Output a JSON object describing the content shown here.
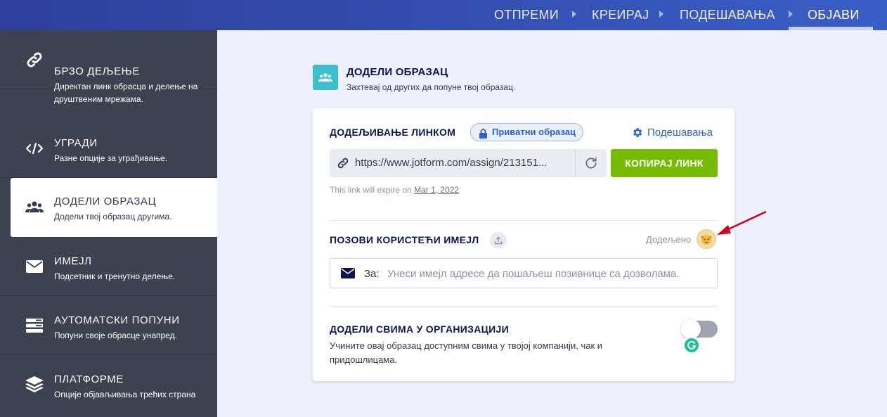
{
  "topnav": {
    "items": [
      "ОТПРЕМИ",
      "КРЕИРАЈ",
      "ПОДЕШАВАЊА",
      "ОБЈАВИ"
    ],
    "active": "ОБЈАВИ"
  },
  "sidebar": {
    "items": [
      {
        "title": "БРЗО ДЕЉЕЊЕ",
        "desc": "Директан линк обрасца и делење на друштвеним мрежама.",
        "icon": "link-icon"
      },
      {
        "title": "УГРАДИ",
        "desc": "Разне опције за уграђивање.",
        "icon": "code-icon"
      },
      {
        "title": "ДОДЕЛИ ОБРАЗАЦ",
        "desc": "Додели твој образац другима.",
        "icon": "users-icon"
      },
      {
        "title": "ИМЕЈЛ",
        "desc": "Подсетник и тренутно делење.",
        "icon": "envelope-icon"
      },
      {
        "title": "АУТОМАТСКИ ПОПУНИ",
        "desc": "Попуни своје обрасце унапред.",
        "icon": "prefill-icon"
      },
      {
        "title": "ПЛАТФОРМЕ",
        "desc": "Опције објављивања трећих страна",
        "icon": "layers-icon"
      }
    ],
    "active_index": 2
  },
  "section": {
    "title": "ДОДЕЛИ ОБРАЗАЦ",
    "subtitle": "Захтевај од других да попуне твој образац."
  },
  "link_section": {
    "label": "ДОДЕЉИВАЊЕ ЛИНКОМ",
    "badge": "Приватни образац",
    "settings": "Подешавања",
    "url": "https://www.jotform.com/assign/213151...",
    "copy_label": "КОПИРАЈ ЛИНК",
    "expire_text": "This link will expire on",
    "expire_date": "Mar 1, 2022"
  },
  "email_section": {
    "label": "ПОЗОВИ КОРИСТЕЋИ ИМЕЈЛ",
    "assigned": "Додељено",
    "to_label": "За:",
    "placeholder": "Унеси имејл адресе да пошаљеш позивнице са дозволама."
  },
  "org_section": {
    "label": "ДОДЕЛИ СВИМА У ОРГАНИЗАЦИЈИ",
    "desc": "Учините овај образац доступним свима у твојој компанији, чак и придошлицама.",
    "toggle_on": false
  },
  "colors": {
    "accent_blue": "#2e5fd2",
    "green_button": "#78bb07",
    "sidebar_bg": "#3c4250",
    "teal_icon": "#3bbfcf",
    "arrow_red": "#d0021b"
  }
}
